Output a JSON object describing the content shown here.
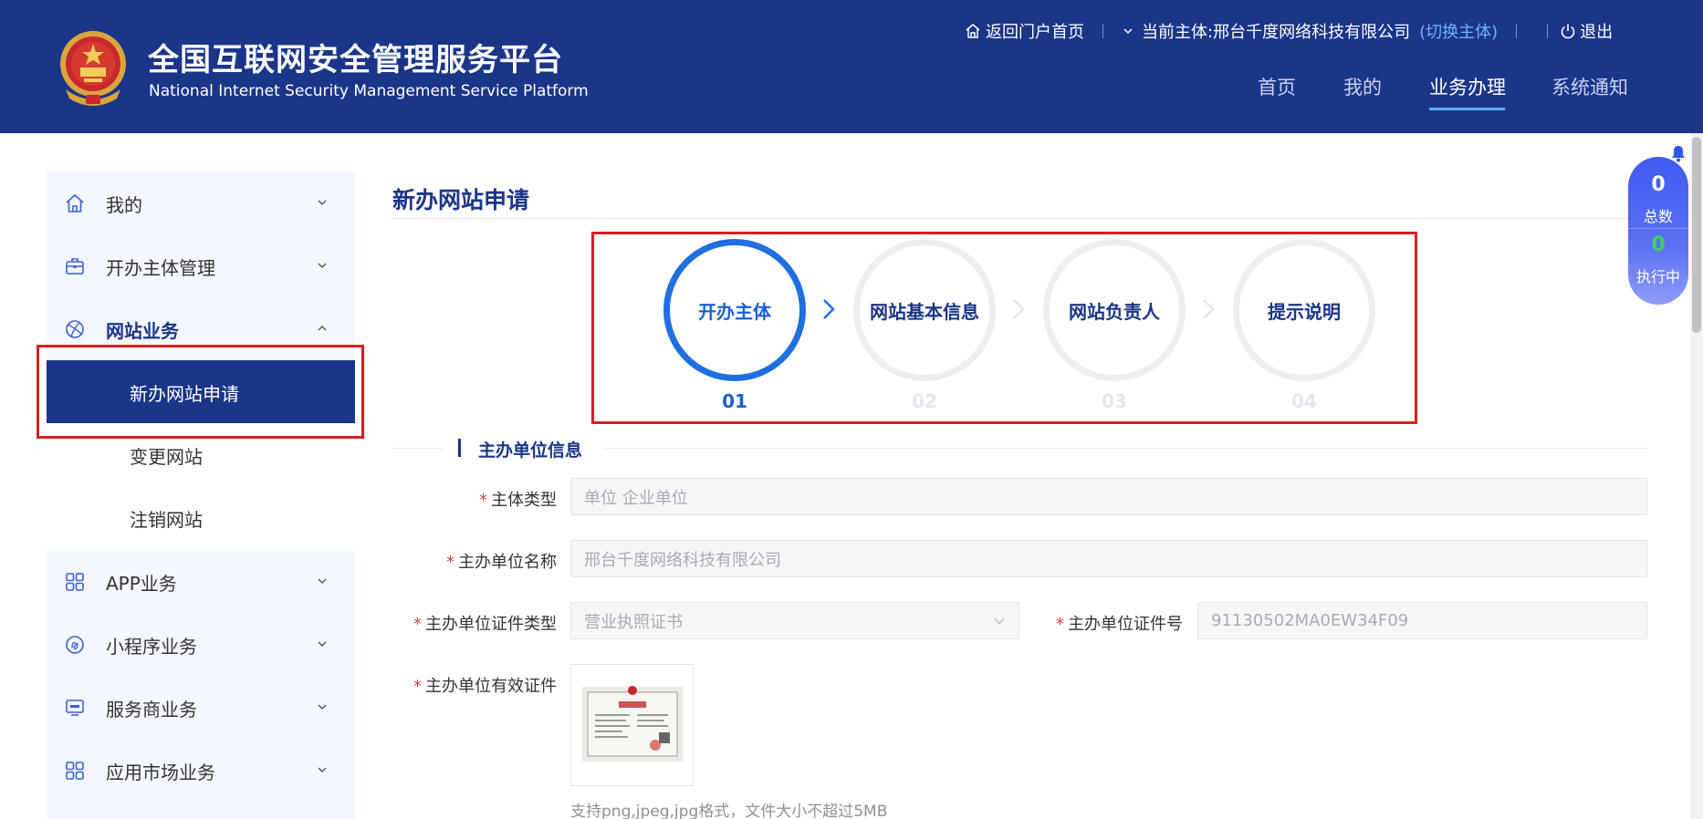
{
  "header": {
    "title": "全国互联网安全管理服务平台",
    "subtitle": "National Internet Security Management Service Platform",
    "topbar": {
      "home_link": "返回门户首页",
      "current_entity_prefix": "当前主体:",
      "current_entity": "邢台千度网络科技有限公司",
      "switch_entity": "(切换主体)",
      "logout": "退出"
    },
    "nav": [
      {
        "label": "首页",
        "active": false
      },
      {
        "label": "我的",
        "active": false
      },
      {
        "label": "业务办理",
        "active": true
      },
      {
        "label": "系统通知",
        "active": false
      }
    ]
  },
  "sidebar": {
    "items": [
      {
        "label": "我的",
        "icon": "home-icon",
        "expanded": false
      },
      {
        "label": "开办主体管理",
        "icon": "briefcase-icon",
        "expanded": false
      },
      {
        "label": "网站业务",
        "icon": "globe-icon",
        "expanded": true
      },
      {
        "label": "APP业务",
        "icon": "apps-grid-icon",
        "expanded": false
      },
      {
        "label": "小程序业务",
        "icon": "mini-program-icon",
        "expanded": false
      },
      {
        "label": "服务商业务",
        "icon": "monitor-icon",
        "expanded": false
      },
      {
        "label": "应用市场业务",
        "icon": "apps-grid-icon",
        "expanded": false
      }
    ],
    "sub_items": [
      {
        "label": "新办网站申请",
        "active": true
      },
      {
        "label": "变更网站",
        "active": false
      },
      {
        "label": "注销网站",
        "active": false
      }
    ]
  },
  "main": {
    "page_title": "新办网站申请",
    "steps": [
      {
        "label": "开办主体",
        "number": "01",
        "active": true
      },
      {
        "label": "网站基本信息",
        "number": "02",
        "active": false
      },
      {
        "label": "网站负责人",
        "number": "03",
        "active": false
      },
      {
        "label": "提示说明",
        "number": "04",
        "active": false
      }
    ],
    "section_title": "主办单位信息",
    "form": {
      "entity_type": {
        "label": "主体类型",
        "value": "单位 企业单位"
      },
      "org_name": {
        "label": "主办单位名称",
        "value": "邢台千度网络科技有限公司"
      },
      "cert_type": {
        "label": "主办单位证件类型",
        "value": "营业执照证书"
      },
      "cert_no": {
        "label": "主办单位证件号",
        "value": "91130502MA0EW34F09"
      },
      "cert_file": {
        "label": "主办单位有效证件"
      }
    },
    "upload_hint": "支持png,jpeg,jpg格式，文件大小不超过5MB"
  },
  "float_panel": {
    "total_count": "0",
    "total_label": "总数",
    "running_count": "0",
    "running_label": "执行中"
  },
  "colors": {
    "header_bg": "#1b3589",
    "accent_blue": "#1e6fe0",
    "highlight_red": "#d62020",
    "required_red": "#e23c3c",
    "running_green": "#3fd25a"
  }
}
